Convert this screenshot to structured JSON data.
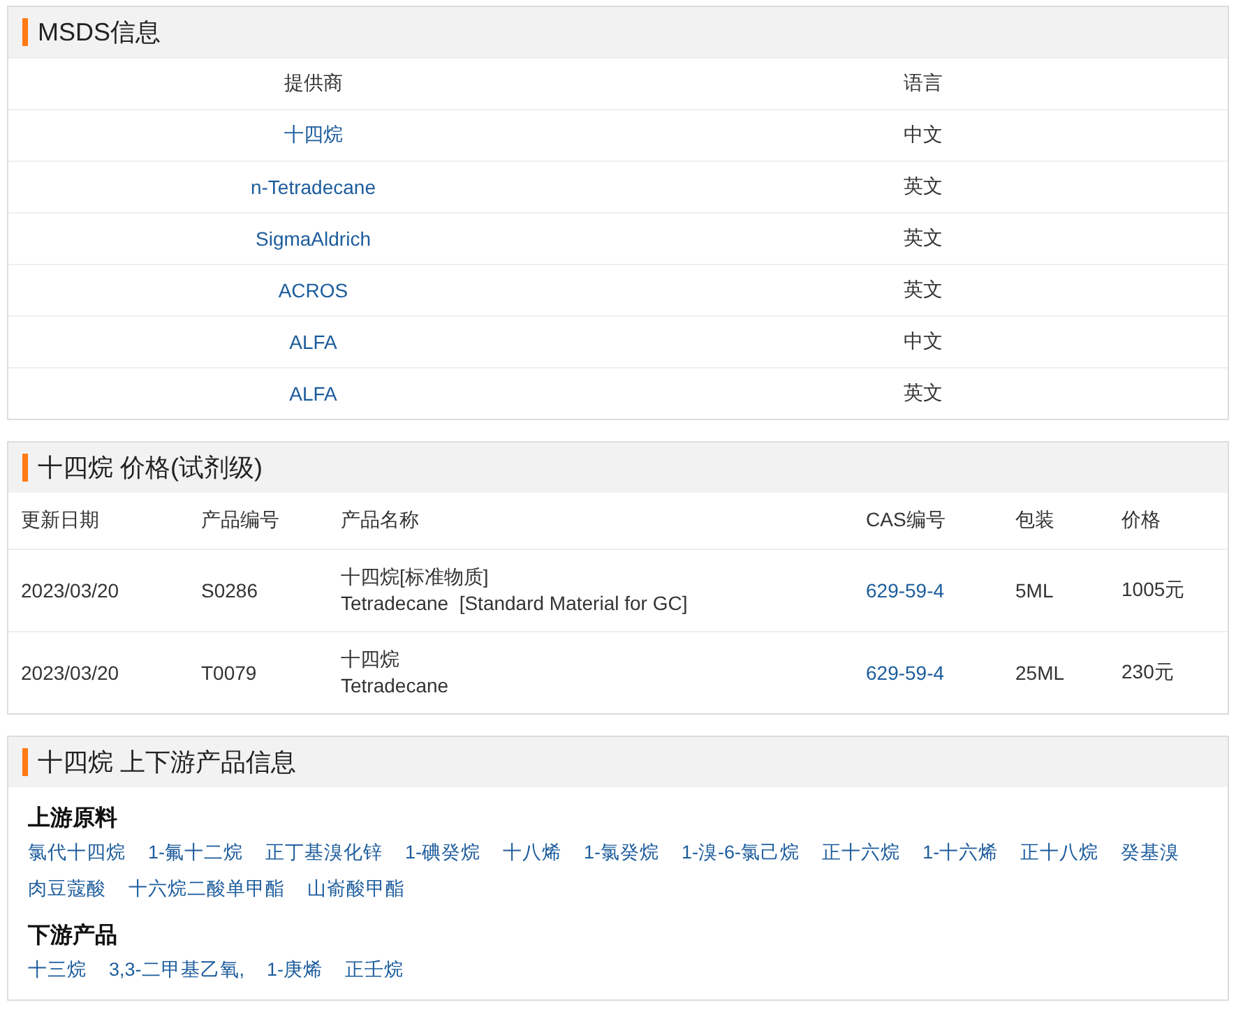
{
  "msds": {
    "title": "MSDS信息",
    "columns": [
      "提供商",
      "语言"
    ],
    "rows": [
      {
        "provider": "十四烷",
        "language": "中文"
      },
      {
        "provider": "n-Tetradecane",
        "language": "英文"
      },
      {
        "provider": "SigmaAldrich",
        "language": "英文"
      },
      {
        "provider": "ACROS",
        "language": "英文"
      },
      {
        "provider": "ALFA",
        "language": "中文"
      },
      {
        "provider": "ALFA",
        "language": "英文"
      }
    ]
  },
  "prices": {
    "title": "十四烷 价格(试剂级)",
    "columns": [
      "更新日期",
      "产品编号",
      "产品名称",
      "CAS编号",
      "包装",
      "价格"
    ],
    "rows": [
      {
        "date": "2023/03/20",
        "code": "S0286",
        "name": "十四烷[标准物质]",
        "name_en": "Tetradecane  [Standard Material for GC]",
        "cas": "629-59-4",
        "package": "5ML",
        "price": "1005元"
      },
      {
        "date": "2023/03/20",
        "code": "T0079",
        "name": "十四烷",
        "name_en": "Tetradecane",
        "cas": "629-59-4",
        "package": "25ML",
        "price": "230元"
      }
    ]
  },
  "chain": {
    "title": "十四烷 上下游产品信息",
    "groups": [
      {
        "heading": "上游原料",
        "items": [
          "氯代十四烷",
          "1-氟十二烷",
          "正丁基溴化锌",
          "1-碘癸烷",
          "十八烯",
          "1-氯癸烷",
          "1-溴-6-氯己烷",
          "正十六烷",
          "1-十六烯",
          "正十八烷",
          "癸基溴",
          "肉豆蔻酸",
          "十六烷二酸单甲酯",
          "山嵛酸甲酯"
        ]
      },
      {
        "heading": "下游产品",
        "items": [
          "十三烷",
          "3,3-二甲基乙氧,",
          "1-庚烯",
          "正壬烷"
        ]
      }
    ]
  }
}
